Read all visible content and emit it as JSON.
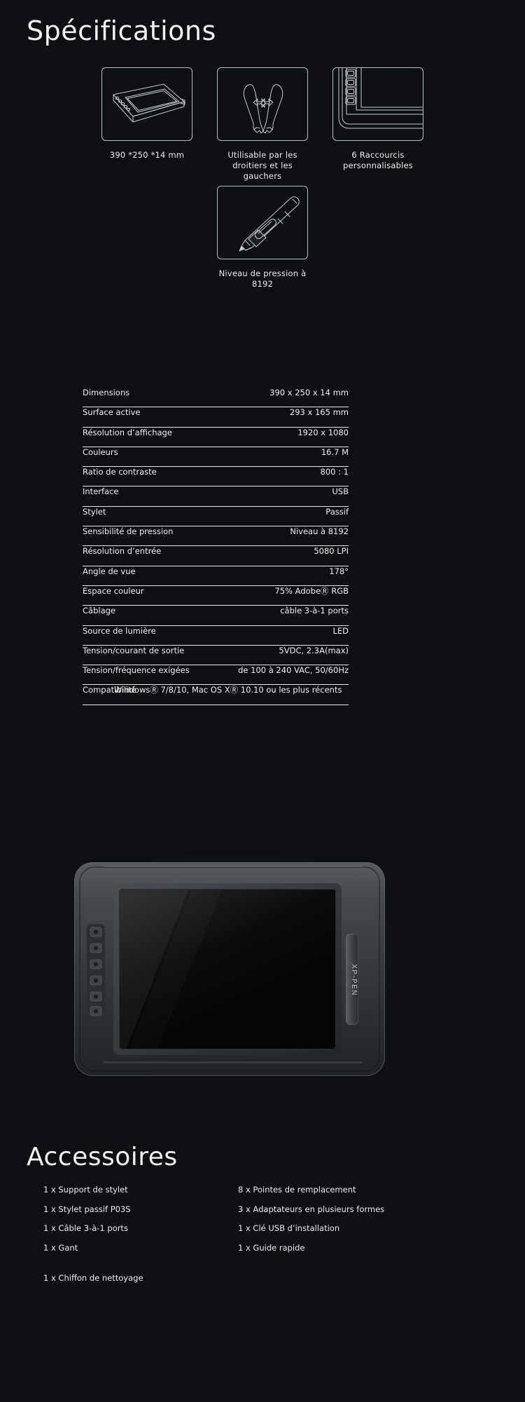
{
  "sections": {
    "spec_title": "Spécifications",
    "accessories_title": "Accessoires"
  },
  "features": [
    {
      "icon": "tablet-isometric-icon",
      "caption": "390 *250 *14 mm"
    },
    {
      "icon": "two-hands-arrow-icon",
      "caption": "Utilisable par les\ndroitiers et les gauchers"
    },
    {
      "icon": "tablet-shortcut-keys-icon",
      "caption": "6 Raccourcis\npersonnalisables"
    },
    {
      "icon": "stylus-pen-icon",
      "caption": "Niveau de pression à 8192"
    }
  ],
  "spec_table": {
    "rows": [
      {
        "label": "Dimensions",
        "value": "390 x 250 x 14 mm"
      },
      {
        "label": "Surface active",
        "value": "293 x 165 mm"
      },
      {
        "label": "Résolution d’affichage",
        "value": "1920 x 1080"
      },
      {
        "label": "Couleurs",
        "value": "16.7 M"
      },
      {
        "label": "Ratio de contraste",
        "value": "800 : 1"
      },
      {
        "label": "Interface",
        "value": "USB"
      },
      {
        "label": "Stylet",
        "value": "Passif"
      },
      {
        "label": "Sensibilité de pression",
        "value": "Niveau à 8192"
      },
      {
        "label": "Résolution d’entrée",
        "value": "5080 LPI"
      },
      {
        "label": "Angle de vue",
        "value": "178°"
      },
      {
        "label": "Espace couleur",
        "value": "75% AdobeⓇ RGB"
      },
      {
        "label": "Câblage",
        "value": "câble 3-à-1 ports"
      },
      {
        "label": "Source de lumière",
        "value": "LED"
      },
      {
        "label": "Tension/courant de sortie",
        "value": "5VDC, 2.3A(max)"
      },
      {
        "label": "Tension/fréquence exigées",
        "value": "de 100 à 240 VAC, 50/60Hz"
      },
      {
        "label": "Compatibilité",
        "value": "WindowsⓇ 7/8/10, Mac OS XⓇ 10.10 ou les plus récents",
        "overlap": true
      }
    ]
  },
  "product_photo": {
    "brand": "XP-PEN",
    "alt": "graphics-tablet-display-front-view"
  },
  "accessories": {
    "left": [
      "1 x Support de stylet",
      "1 x Stylet passif P03S",
      "1 x Câble 3-à-1 ports",
      "1 x Gant",
      "1 x Chiffon de nettoyage"
    ],
    "right": [
      "8 x Pointes de remplacement",
      "3 x Adaptateurs en plusieurs formes",
      "1 x Clé USB d’installation",
      "1 x Guide rapide"
    ]
  },
  "colors": {
    "background": "#0d0f12",
    "text": "#f0f0f0",
    "rule": "#e8e8e8",
    "icon_stroke": "#c9ccd0"
  }
}
